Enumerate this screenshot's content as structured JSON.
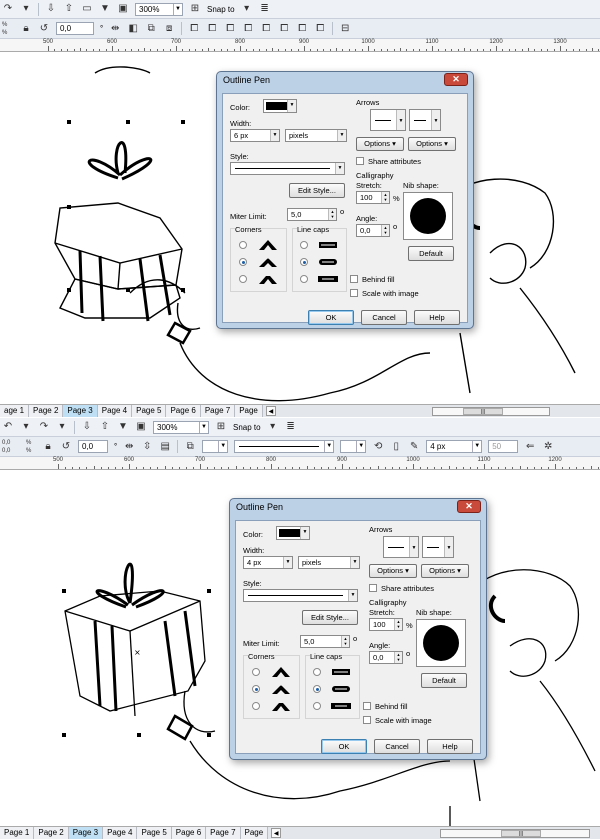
{
  "toolbar": {
    "zoom": "300%",
    "snap_to": "Snap to",
    "rotation_value": "0,0",
    "degree_symbol": "°",
    "pct_label": "%",
    "line_width_value": "4 px",
    "number_50": "50",
    "pos_values": [
      "0,0",
      "0,0"
    ]
  },
  "ruler": {
    "ticks1": [
      "500",
      "600",
      "700",
      "800",
      "900",
      "1000",
      "1100",
      "1200",
      "1300"
    ],
    "ticks2": [
      "500",
      "600",
      "700",
      "800",
      "900",
      "1000",
      "1100",
      "1200",
      "1300"
    ]
  },
  "pages": {
    "tabs": [
      "Page 1",
      "Page 2",
      "Page 3",
      "Page 4",
      "Page 5",
      "Page 6",
      "Page 7",
      "Page"
    ],
    "active": "Page 3",
    "first_tab_1": "age 1",
    "thumb": "|||"
  },
  "dialog1": {
    "title": "Outline Pen",
    "color_label": "Color:",
    "width_label": "Width:",
    "width_value": "6 px",
    "units_value": "pixels",
    "style_label": "Style:",
    "edit_style": "Edit Style...",
    "miter_label": "Miter Limit:",
    "miter_value": "5,0",
    "corners_label": "Corners",
    "linecaps_label": "Line caps",
    "arrows_label": "Arrows",
    "options1": "Options",
    "options2": "Options",
    "share_attr": "Share attributes",
    "calligraphy_label": "Calligraphy",
    "stretch_label": "Stretch:",
    "stretch_value": "100",
    "pct": "%",
    "nib_label": "Nib shape:",
    "angle_label": "Angle:",
    "angle_value": "0,0",
    "deg": "o",
    "default_btn": "Default",
    "behind_fill": "Behind fill",
    "scale_image": "Scale with image",
    "ok": "OK",
    "cancel": "Cancel",
    "help": "Help"
  },
  "dialog2": {
    "title": "Outline Pen",
    "color_label": "Color:",
    "width_label": "Width:",
    "width_value": "4 px",
    "units_value": "pixels",
    "style_label": "Style:",
    "edit_style": "Edit Style...",
    "miter_label": "Miter Limit:",
    "miter_value": "5,0",
    "corners_label": "Corners",
    "linecaps_label": "Line caps",
    "arrows_label": "Arrows",
    "options1": "Options",
    "options2": "Options",
    "share_attr": "Share attributes",
    "calligraphy_label": "Calligraphy",
    "stretch_label": "Stretch:",
    "stretch_value": "100",
    "pct": "%",
    "nib_label": "Nib shape:",
    "angle_label": "Angle:",
    "angle_value": "0,0",
    "deg": "o",
    "default_btn": "Default",
    "behind_fill": "Behind fill",
    "scale_image": "Scale with image",
    "ok": "OK",
    "cancel": "Cancel",
    "help": "Help"
  }
}
